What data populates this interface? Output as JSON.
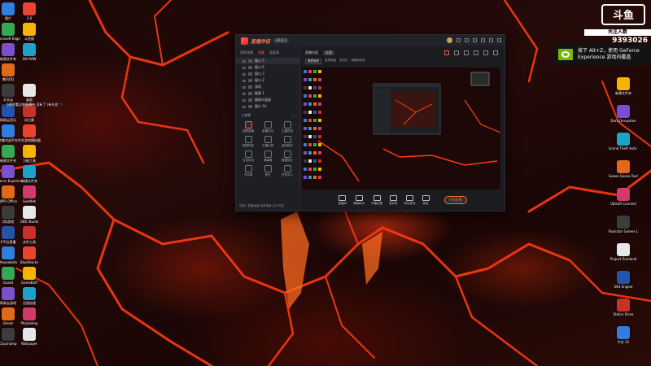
{
  "desktop": {
    "left_icons": [
      [
        "图片",
        "3.0"
      ],
      [
        "Microsoft Edge",
        "斗鱼版"
      ],
      [
        "新建文件夹",
        "SW RAW"
      ],
      [
        "腾讯QQ"
      ],
      [
        "天天云",
        "桌面"
      ],
      [
        "网易云音乐",
        "向日葵"
      ],
      [
        "完美对战平台",
        "中文游戏模拟器"
      ],
      [
        "新建文件夹",
        "万能工具"
      ],
      [
        "GeForce Experience",
        "新建文件夹"
      ],
      [
        "WPS Office",
        "SeaWeb"
      ],
      [
        "QQ游戏",
        "OBS Studio"
      ],
      [
        "X平台直播",
        "文件工具"
      ],
      [
        "Mousebeta",
        "BlueStacks"
      ],
      [
        "Guard",
        "GameBuff"
      ],
      [
        "网易云游戏",
        "迅游加速"
      ],
      [
        "Steam",
        "Photoshop"
      ],
      [
        "Clipchamp",
        "Wallpaper"
      ]
    ],
    "right_icons": [
      "新建文件夹",
      "Dark Deception",
      "Grand Theft Auto V",
      "Goose Goose Duck",
      "Ubisoft Connect",
      "Rockstar Games Launcher",
      "Project Zomboid",
      "UE4 Engine",
      "Stellar Drive",
      "中文 21"
    ]
  },
  "window": {
    "title": "直播伴侣",
    "version": "v5.6.1",
    "left_tabs": [
      "我的场景",
      "场景",
      "画面源"
    ],
    "scenes": [
      "窗口 5",
      "窗口 6",
      "窗口 3",
      "窗口 2",
      "游戏",
      "截屏 1",
      "摄像头画面",
      "窗口 10"
    ],
    "add_source": "三来源",
    "tools": [
      "视频直播",
      "直播互动",
      "主播连线",
      "美颜特效",
      "主播礼物",
      "游戏助手",
      "互动玩法",
      "弹幕墙",
      "数据统计",
      "节目单",
      "音乐",
      "任务中心"
    ],
    "left_footer": "场景1 直播画面 游戏场景 合计内容",
    "main_tabs": [
      "直播内容",
      "全屏"
    ],
    "sub_tabs": [
      "横屏画面",
      "竖屏画面",
      "多机位",
      "直播间装饰"
    ],
    "bottom_actions": [
      "直播间",
      "弹幕助手",
      "开播设置",
      "麦克风",
      "伴侣音效",
      "音量",
      "开播"
    ],
    "go_live": "开始直播"
  },
  "overlay": {
    "platform_logo": "斗鱼",
    "followers_label": "关注人数",
    "room_id": "9393026",
    "nvidia_line1": "按下 Alt+Z，使用 GeForce",
    "nvidia_line2": "Experience 游戏内覆盖"
  },
  "chat": {
    "line": "当前你看过的直播中 没有了 (有头发！)"
  },
  "colors": {
    "accent": "#ff5a3a",
    "lava": "#ff3a12",
    "nvidia_green": "#76b900"
  }
}
